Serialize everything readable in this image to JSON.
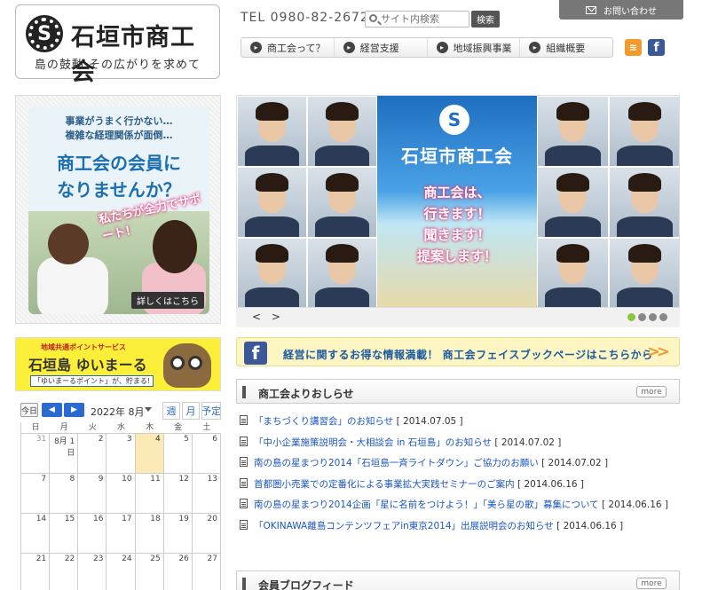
{
  "header": {
    "logo_name": "石垣市商工会",
    "logo_tagline": "島の鼓動 その広がりを求めて",
    "tel": "TEL 0980-82-2672",
    "search_placeholder": "サイト内検索",
    "search_button": "検索",
    "contact": "お問い合わせ",
    "nav": [
      "商工会って？",
      "経営支援",
      "地域振興事業",
      "組織概要"
    ]
  },
  "join_banner": {
    "line1": "事業がうまく行かない…",
    "line2": "複雑な経理関係が面倒…",
    "line3": "商工会の会員に",
    "line4": "なりませんか？",
    "slogan": "私たちが全力でサポート！",
    "more": "詳しくはこちら"
  },
  "yuimaaru_banner": {
    "tag": "地域共通ポイントサービス",
    "name": "石垣島 ゆいまーる",
    "sub": "「ゆいまーるポイント」が、貯まる!"
  },
  "calendar": {
    "today_label": "今日",
    "month_label": "2022年 8月",
    "views": [
      "週",
      "月",
      "予定"
    ],
    "weekdays": [
      "日",
      "月",
      "火",
      "水",
      "木",
      "金",
      "土"
    ],
    "weeks": [
      [
        "31",
        "8月 1日",
        "2",
        "3",
        "4",
        "5",
        "6"
      ],
      [
        "7",
        "8",
        "9",
        "10",
        "11",
        "12",
        "13"
      ],
      [
        "14",
        "15",
        "16",
        "17",
        "18",
        "19",
        "20"
      ],
      [
        "21",
        "22",
        "23",
        "24",
        "25",
        "26",
        "27"
      ]
    ]
  },
  "slider": {
    "org_name": "石垣市商工会",
    "line1": "商工会は、",
    "line2": "行きます！",
    "line3": "聞きます！",
    "line4": "提案します！",
    "prev_next": "< >"
  },
  "fb_banner": {
    "text": "経営に関するお得な情報満載！ 商工会フェイスブックページはこちらから",
    "arrow": ">>"
  },
  "news": {
    "title": "商工会よりおしらせ",
    "more": "more",
    "items": [
      {
        "text": "「まちづくり講習会」のお知らせ",
        "date": "[ 2014.07.05 ]"
      },
      {
        "text": "「中小企業施策説明会・大相談会 in 石垣島」のお知らせ",
        "date": "[ 2014.07.02 ]"
      },
      {
        "text": "南の島の星まつり2014「石垣島一斉ライトダウン」ご協力のお願い",
        "date": "[ 2014.07.02 ]"
      },
      {
        "text": "首都圏小売業での定番化による事業拡大実践セミナーのご案内",
        "date": "[ 2014.06.16 ]"
      },
      {
        "text": "南の島の星まつり2014企画「星に名前をつけよう！」「美ら星の歌」募集について",
        "date": "[ 2014.06.16 ]"
      },
      {
        "text": "「OKINAWA離島コンテンツフェアin東京2014」出展説明会のお知らせ",
        "date": "[ 2014.06.16 ]"
      }
    ]
  },
  "blog": {
    "title": "会員ブログフィード",
    "more": "more"
  },
  "colors": {
    "link": "#1a55c2",
    "facebook": "#3b5998",
    "accent_orange": "#f39a2b",
    "today_cell": "#fbe9b6"
  }
}
